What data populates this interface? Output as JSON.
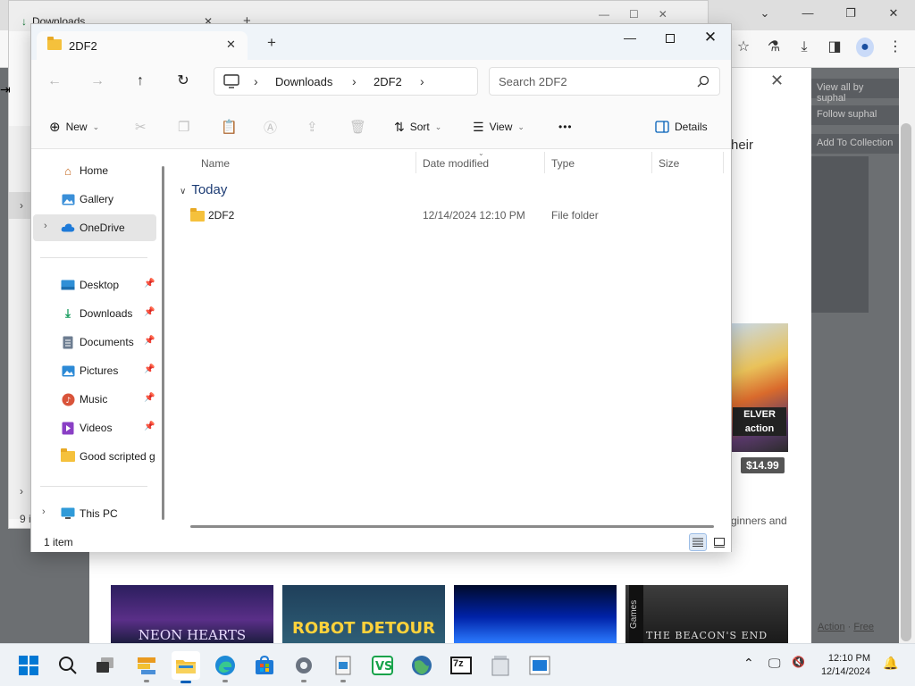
{
  "background_browser": {
    "tab_title": "Downloads",
    "page_partial_text": "heir",
    "sidebar_buttons": [
      "View all by suphal",
      "Follow suphal",
      "Add To Collection"
    ],
    "game_art_text": "ELVER action",
    "price": "$14.99",
    "partial_desc": "ginners and",
    "footer_links": [
      "Action",
      "Free"
    ],
    "thumbnails": [
      "NEON HEARTS",
      "ROBOT DETOUR",
      "",
      "THE BEACON'S END"
    ],
    "thumbnail_side": "Games",
    "status_partial": "9 i"
  },
  "explorer": {
    "tab_label": "2DF2",
    "new_tab": "+",
    "window_controls": {
      "minimize": "—",
      "close": "✕"
    },
    "nav": {
      "back": "←",
      "forward": "→",
      "up": "↑",
      "refresh": "↻"
    },
    "breadcrumb": [
      "Downloads",
      "2DF2"
    ],
    "search_placeholder": "Search 2DF2",
    "commands": {
      "new": "New",
      "sort": "Sort",
      "view": "View",
      "more": "•••",
      "details": "Details"
    },
    "nav_pane": {
      "home": "Home",
      "gallery": "Gallery",
      "onedrive": "OneDrive",
      "desktop": "Desktop",
      "downloads": "Downloads",
      "documents": "Documents",
      "pictures": "Pictures",
      "music": "Music",
      "videos": "Videos",
      "good_scripted": "Good scripted g",
      "this_pc": "This PC"
    },
    "columns": [
      "Name",
      "Date modified",
      "Type",
      "Size"
    ],
    "group": "Today",
    "files": [
      {
        "name": "2DF2",
        "date_modified": "12/14/2024 12:10 PM",
        "type": "File folder",
        "size": ""
      }
    ],
    "status": "1 item"
  },
  "taskbar": {
    "clock_time": "12:10 PM",
    "clock_date": "12/14/2024",
    "seven_zip": "7z",
    "accent": "#005fb8"
  }
}
